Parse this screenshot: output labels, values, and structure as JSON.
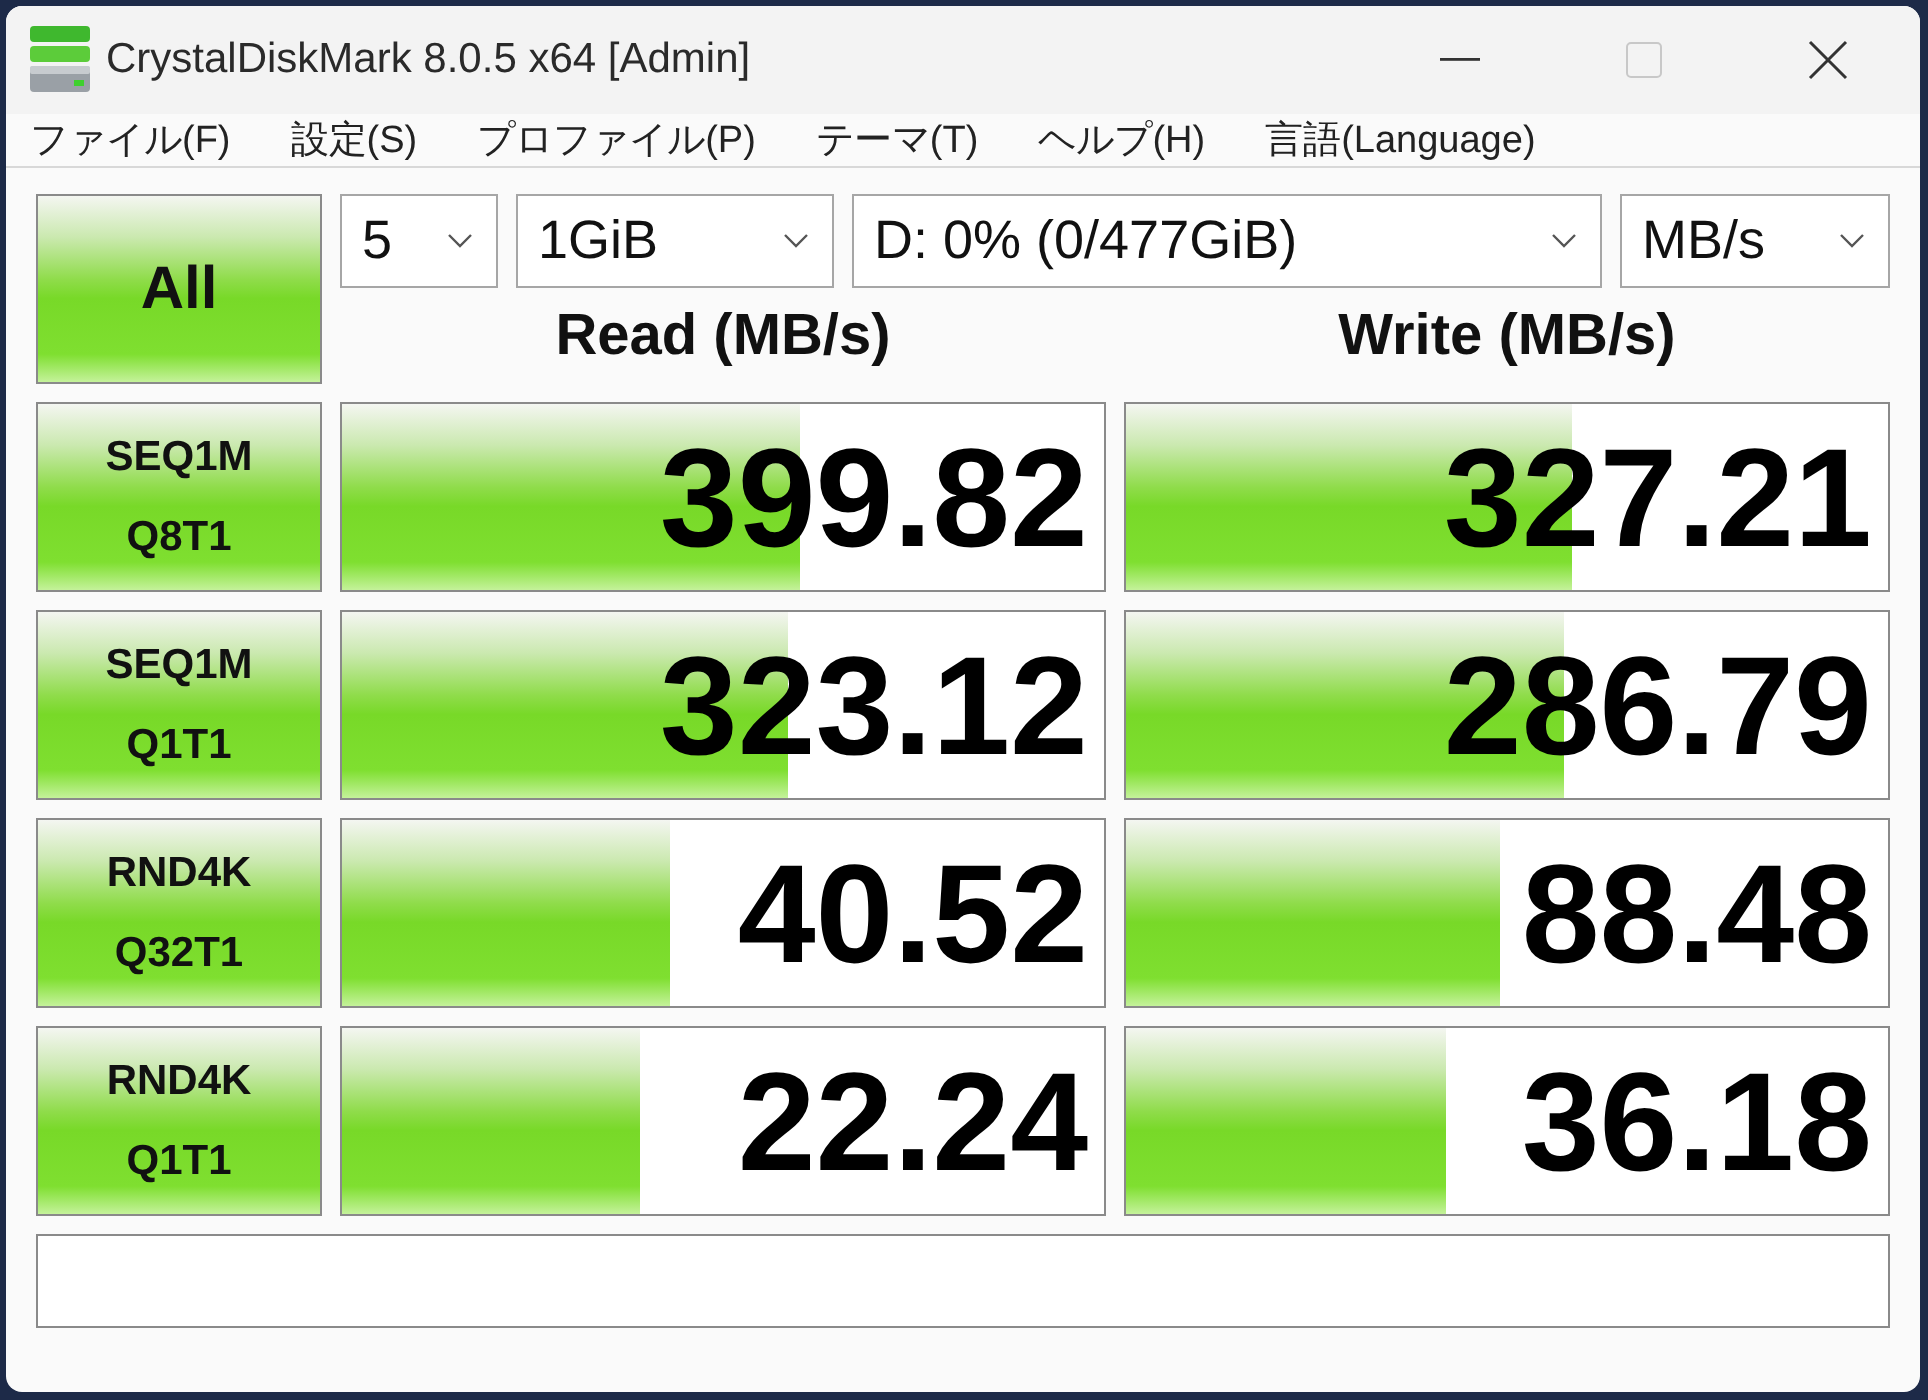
{
  "window": {
    "title": "CrystalDiskMark 8.0.5 x64 [Admin]"
  },
  "menu": [
    "ファイル(F)",
    "設定(S)",
    "プロファイル(P)",
    "テーマ(T)",
    "ヘルプ(H)",
    "言語(Language)"
  ],
  "all_button": "All",
  "selectors": [
    {
      "value": "5"
    },
    {
      "value": "1GiB"
    },
    {
      "value": "D: 0% (0/477GiB)"
    },
    {
      "value": "MB/s"
    }
  ],
  "columns": [
    "Read (MB/s)",
    "Write (MB/s)"
  ],
  "tests": [
    {
      "label": "SEQ1M",
      "detail": "Q8T1",
      "read": {
        "value": "399.82",
        "level": 0.6
      },
      "write": {
        "value": "327.21",
        "level": 0.585
      }
    },
    {
      "label": "SEQ1M",
      "detail": "Q1T1",
      "read": {
        "value": "323.12",
        "level": 0.585
      },
      "write": {
        "value": "286.79",
        "level": 0.574
      }
    },
    {
      "label": "RND4K",
      "detail": "Q32T1",
      "read": {
        "value": "40.52",
        "level": 0.43
      },
      "write": {
        "value": "88.48",
        "level": 0.49
      }
    },
    {
      "label": "RND4K",
      "detail": "Q1T1",
      "read": {
        "value": "22.24",
        "level": 0.39
      },
      "write": {
        "value": "36.18",
        "level": 0.42
      }
    }
  ]
}
